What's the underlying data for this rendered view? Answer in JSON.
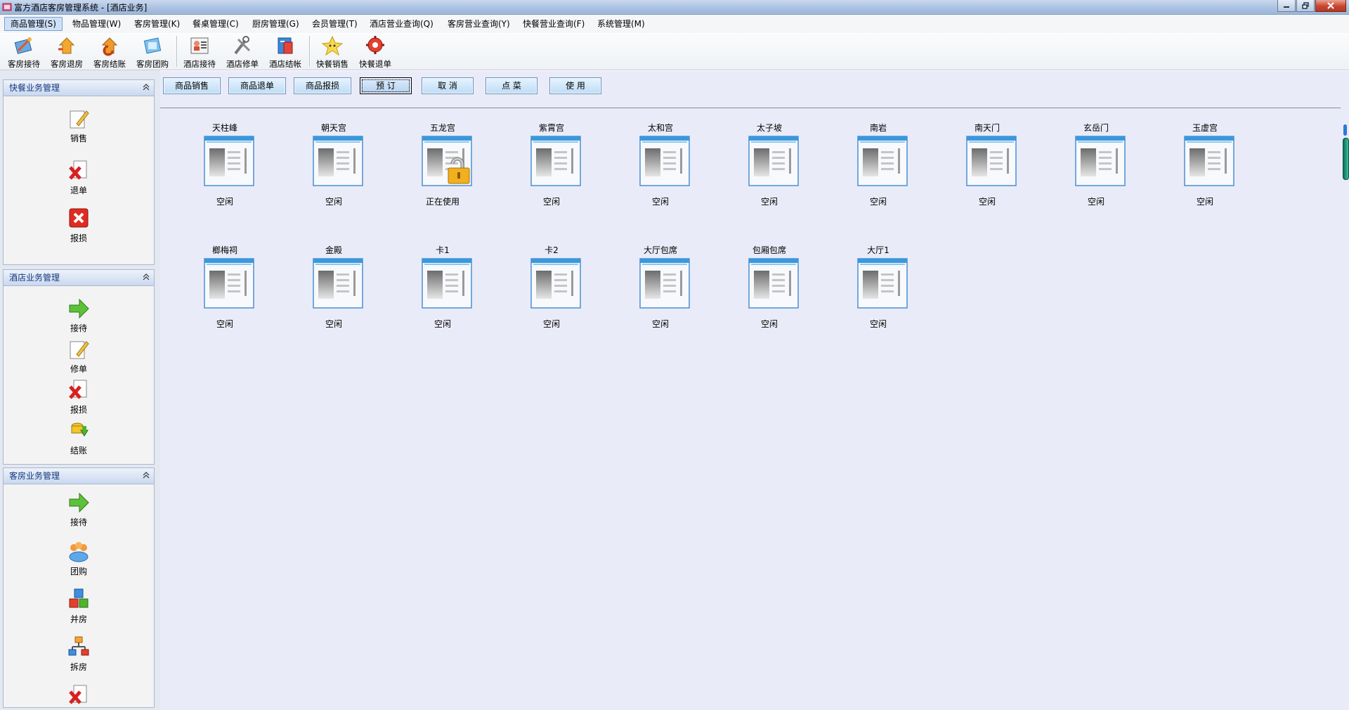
{
  "window": {
    "title": "富方酒店客房管理系统 - [酒店业务]"
  },
  "menu": [
    {
      "label": "商品管理(S)",
      "active": true
    },
    {
      "label": "物品管理(W)"
    },
    {
      "label": "客房管理(K)"
    },
    {
      "label": "餐桌管理(C)"
    },
    {
      "label": "厨房管理(G)"
    },
    {
      "label": "会员管理(T)"
    },
    {
      "label": "酒店营业查询(Q)"
    },
    {
      "label": "客房营业查询(Y)"
    },
    {
      "label": "快餐营业查询(F)"
    },
    {
      "label": "系统管理(M)"
    }
  ],
  "toolbar": [
    {
      "label": "客房接待",
      "icon": "room-checkin-icon"
    },
    {
      "label": "客房退房",
      "icon": "room-checkout-icon"
    },
    {
      "label": "客房结账",
      "icon": "room-settle-icon"
    },
    {
      "label": "客房团购",
      "icon": "room-group-icon"
    },
    {
      "label": "酒店接待",
      "icon": "hotel-reception-icon"
    },
    {
      "label": "酒店修单",
      "icon": "hotel-edit-order-icon"
    },
    {
      "label": "酒店结帐",
      "icon": "hotel-settle-icon"
    },
    {
      "label": "快餐销售",
      "icon": "fastfood-sale-icon"
    },
    {
      "label": "快餐退单",
      "icon": "fastfood-refund-icon"
    }
  ],
  "sidebar": {
    "fastfood": {
      "title": "快餐业务管理",
      "items": [
        {
          "label": "销售",
          "icon": "pencil-icon"
        },
        {
          "label": "退单",
          "icon": "document-x-icon"
        },
        {
          "label": "报损",
          "icon": "red-x-icon"
        }
      ]
    },
    "hotel": {
      "title": "酒店业务管理",
      "items": [
        {
          "label": "接待",
          "icon": "green-arrow-icon"
        },
        {
          "label": "修单",
          "icon": "pencil-icon"
        },
        {
          "label": "报损",
          "icon": "document-x-icon"
        },
        {
          "label": "结账",
          "icon": "coins-icon"
        }
      ]
    },
    "room": {
      "title": "客房业务管理",
      "items": [
        {
          "label": "接待",
          "icon": "green-arrow-icon"
        },
        {
          "label": "团购",
          "icon": "people-group-icon"
        },
        {
          "label": "并房",
          "icon": "cubes-icon"
        },
        {
          "label": "拆房",
          "icon": "hierarchy-icon"
        },
        {
          "label": "",
          "icon": "document-x-icon"
        }
      ]
    }
  },
  "actions": [
    {
      "label": "商品销售"
    },
    {
      "label": "商品退单"
    },
    {
      "label": "商品报损"
    },
    {
      "label": "预  订",
      "selected": true
    },
    {
      "label": "取  消"
    },
    {
      "label": "点  菜"
    },
    {
      "label": "使  用"
    }
  ],
  "rooms": [
    {
      "name": "天柱峰",
      "status": "空闲"
    },
    {
      "name": "朝天宫",
      "status": "空闲"
    },
    {
      "name": "五龙宫",
      "status": "正在使用",
      "locked": true
    },
    {
      "name": "紫霄宫",
      "status": "空闲"
    },
    {
      "name": "太和宫",
      "status": "空闲"
    },
    {
      "name": "太子坡",
      "status": "空闲"
    },
    {
      "name": "南岩",
      "status": "空闲"
    },
    {
      "name": "南天门",
      "status": "空闲"
    },
    {
      "name": "玄岳门",
      "status": "空闲"
    },
    {
      "name": "玉虚宫",
      "status": "空闲"
    },
    {
      "name": "榔梅祠",
      "status": "空闲"
    },
    {
      "name": "金殿",
      "status": "空闲"
    },
    {
      "name": "卡1",
      "status": "空闲"
    },
    {
      "name": "卡2",
      "status": "空闲"
    },
    {
      "name": "大厅包席",
      "status": "空闲"
    },
    {
      "name": "包厢包席",
      "status": "空闲"
    },
    {
      "name": "大厅1",
      "status": "空闲"
    }
  ]
}
